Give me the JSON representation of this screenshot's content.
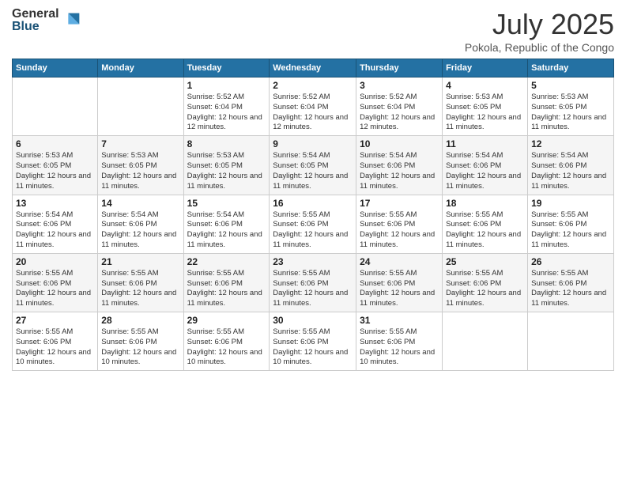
{
  "header": {
    "logo_general": "General",
    "logo_blue": "Blue",
    "month_year": "July 2025",
    "location": "Pokola, Republic of the Congo"
  },
  "days_of_week": [
    "Sunday",
    "Monday",
    "Tuesday",
    "Wednesday",
    "Thursday",
    "Friday",
    "Saturday"
  ],
  "weeks": [
    [
      {
        "day": "",
        "info": ""
      },
      {
        "day": "",
        "info": ""
      },
      {
        "day": "1",
        "info": "Sunrise: 5:52 AM\nSunset: 6:04 PM\nDaylight: 12 hours and 12 minutes."
      },
      {
        "day": "2",
        "info": "Sunrise: 5:52 AM\nSunset: 6:04 PM\nDaylight: 12 hours and 12 minutes."
      },
      {
        "day": "3",
        "info": "Sunrise: 5:52 AM\nSunset: 6:04 PM\nDaylight: 12 hours and 12 minutes."
      },
      {
        "day": "4",
        "info": "Sunrise: 5:53 AM\nSunset: 6:05 PM\nDaylight: 12 hours and 11 minutes."
      },
      {
        "day": "5",
        "info": "Sunrise: 5:53 AM\nSunset: 6:05 PM\nDaylight: 12 hours and 11 minutes."
      }
    ],
    [
      {
        "day": "6",
        "info": "Sunrise: 5:53 AM\nSunset: 6:05 PM\nDaylight: 12 hours and 11 minutes."
      },
      {
        "day": "7",
        "info": "Sunrise: 5:53 AM\nSunset: 6:05 PM\nDaylight: 12 hours and 11 minutes."
      },
      {
        "day": "8",
        "info": "Sunrise: 5:53 AM\nSunset: 6:05 PM\nDaylight: 12 hours and 11 minutes."
      },
      {
        "day": "9",
        "info": "Sunrise: 5:54 AM\nSunset: 6:05 PM\nDaylight: 12 hours and 11 minutes."
      },
      {
        "day": "10",
        "info": "Sunrise: 5:54 AM\nSunset: 6:06 PM\nDaylight: 12 hours and 11 minutes."
      },
      {
        "day": "11",
        "info": "Sunrise: 5:54 AM\nSunset: 6:06 PM\nDaylight: 12 hours and 11 minutes."
      },
      {
        "day": "12",
        "info": "Sunrise: 5:54 AM\nSunset: 6:06 PM\nDaylight: 12 hours and 11 minutes."
      }
    ],
    [
      {
        "day": "13",
        "info": "Sunrise: 5:54 AM\nSunset: 6:06 PM\nDaylight: 12 hours and 11 minutes."
      },
      {
        "day": "14",
        "info": "Sunrise: 5:54 AM\nSunset: 6:06 PM\nDaylight: 12 hours and 11 minutes."
      },
      {
        "day": "15",
        "info": "Sunrise: 5:54 AM\nSunset: 6:06 PM\nDaylight: 12 hours and 11 minutes."
      },
      {
        "day": "16",
        "info": "Sunrise: 5:55 AM\nSunset: 6:06 PM\nDaylight: 12 hours and 11 minutes."
      },
      {
        "day": "17",
        "info": "Sunrise: 5:55 AM\nSunset: 6:06 PM\nDaylight: 12 hours and 11 minutes."
      },
      {
        "day": "18",
        "info": "Sunrise: 5:55 AM\nSunset: 6:06 PM\nDaylight: 12 hours and 11 minutes."
      },
      {
        "day": "19",
        "info": "Sunrise: 5:55 AM\nSunset: 6:06 PM\nDaylight: 12 hours and 11 minutes."
      }
    ],
    [
      {
        "day": "20",
        "info": "Sunrise: 5:55 AM\nSunset: 6:06 PM\nDaylight: 12 hours and 11 minutes."
      },
      {
        "day": "21",
        "info": "Sunrise: 5:55 AM\nSunset: 6:06 PM\nDaylight: 12 hours and 11 minutes."
      },
      {
        "day": "22",
        "info": "Sunrise: 5:55 AM\nSunset: 6:06 PM\nDaylight: 12 hours and 11 minutes."
      },
      {
        "day": "23",
        "info": "Sunrise: 5:55 AM\nSunset: 6:06 PM\nDaylight: 12 hours and 11 minutes."
      },
      {
        "day": "24",
        "info": "Sunrise: 5:55 AM\nSunset: 6:06 PM\nDaylight: 12 hours and 11 minutes."
      },
      {
        "day": "25",
        "info": "Sunrise: 5:55 AM\nSunset: 6:06 PM\nDaylight: 12 hours and 11 minutes."
      },
      {
        "day": "26",
        "info": "Sunrise: 5:55 AM\nSunset: 6:06 PM\nDaylight: 12 hours and 11 minutes."
      }
    ],
    [
      {
        "day": "27",
        "info": "Sunrise: 5:55 AM\nSunset: 6:06 PM\nDaylight: 12 hours and 10 minutes."
      },
      {
        "day": "28",
        "info": "Sunrise: 5:55 AM\nSunset: 6:06 PM\nDaylight: 12 hours and 10 minutes."
      },
      {
        "day": "29",
        "info": "Sunrise: 5:55 AM\nSunset: 6:06 PM\nDaylight: 12 hours and 10 minutes."
      },
      {
        "day": "30",
        "info": "Sunrise: 5:55 AM\nSunset: 6:06 PM\nDaylight: 12 hours and 10 minutes."
      },
      {
        "day": "31",
        "info": "Sunrise: 5:55 AM\nSunset: 6:06 PM\nDaylight: 12 hours and 10 minutes."
      },
      {
        "day": "",
        "info": ""
      },
      {
        "day": "",
        "info": ""
      }
    ]
  ]
}
